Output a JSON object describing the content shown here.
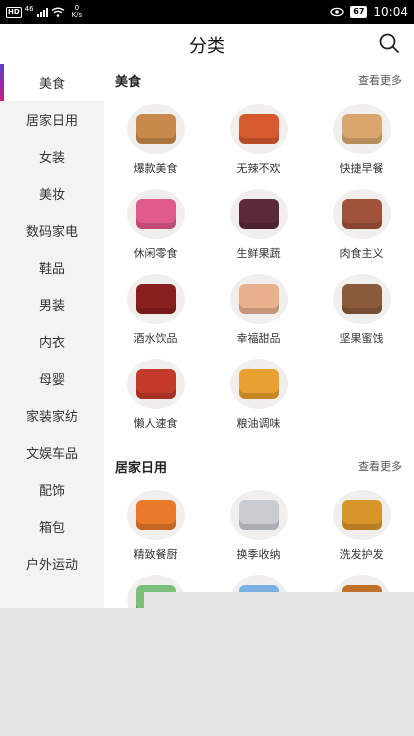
{
  "status_bar": {
    "left_badges": [
      "HD",
      "46"
    ],
    "net_speed_value": "0",
    "net_speed_unit": "K/s",
    "battery": "67",
    "time": "10:04"
  },
  "header": {
    "title": "分类",
    "search_icon": "search-icon"
  },
  "sidebar": {
    "items": [
      {
        "label": "美食",
        "active": true
      },
      {
        "label": "居家日用"
      },
      {
        "label": "女装"
      },
      {
        "label": "美妆"
      },
      {
        "label": "数码家电"
      },
      {
        "label": "鞋品"
      },
      {
        "label": "男装"
      },
      {
        "label": "内衣"
      },
      {
        "label": "母婴"
      },
      {
        "label": "家装家纺"
      },
      {
        "label": "文娱车品"
      },
      {
        "label": "配饰"
      },
      {
        "label": "箱包"
      },
      {
        "label": "户外运动"
      }
    ]
  },
  "sections": [
    {
      "title": "美食",
      "more": "查看更多",
      "items": [
        {
          "label": "爆款美食",
          "icon": "snack-food-icon",
          "color": "#c88a4a"
        },
        {
          "label": "无辣不欢",
          "icon": "spicy-meat-icon",
          "color": "#d65a2e"
        },
        {
          "label": "快捷早餐",
          "icon": "bread-icon",
          "color": "#d9a66b"
        },
        {
          "label": "休闲零食",
          "icon": "snack-bag-icon",
          "color": "#e05a8a"
        },
        {
          "label": "生鲜果蔬",
          "icon": "fruit-icon",
          "color": "#5b2a3a"
        },
        {
          "label": "肉食主义",
          "icon": "meat-box-icon",
          "color": "#a0523a"
        },
        {
          "label": "酒水饮品",
          "icon": "bottles-icon",
          "color": "#8a1f1f"
        },
        {
          "label": "幸福甜品",
          "icon": "macaron-icon",
          "color": "#e8b08c"
        },
        {
          "label": "坚果蜜饯",
          "icon": "nuts-icon",
          "color": "#8a5a3a"
        },
        {
          "label": "懒人速食",
          "icon": "noodles-icon",
          "color": "#c43a2a"
        },
        {
          "label": "粮油调味",
          "icon": "oil-icon",
          "color": "#e8a030"
        }
      ]
    },
    {
      "title": "居家日用",
      "more": "查看更多",
      "items": [
        {
          "label": "精致餐厨",
          "icon": "pot-icon",
          "color": "#e87a2a"
        },
        {
          "label": "换季收纳",
          "icon": "storage-drawer-icon",
          "color": "#c8ccd0"
        },
        {
          "label": "洗发护发",
          "icon": "shampoo-icon",
          "color": "#d8952a"
        },
        {
          "label": "",
          "icon": "tissue-icon",
          "color": "#7ac07a"
        },
        {
          "label": "",
          "icon": "cleaning-icon",
          "color": "#7ab0e0"
        },
        {
          "label": "",
          "icon": "liquid-bottle-icon",
          "color": "#c0702a"
        }
      ]
    }
  ]
}
